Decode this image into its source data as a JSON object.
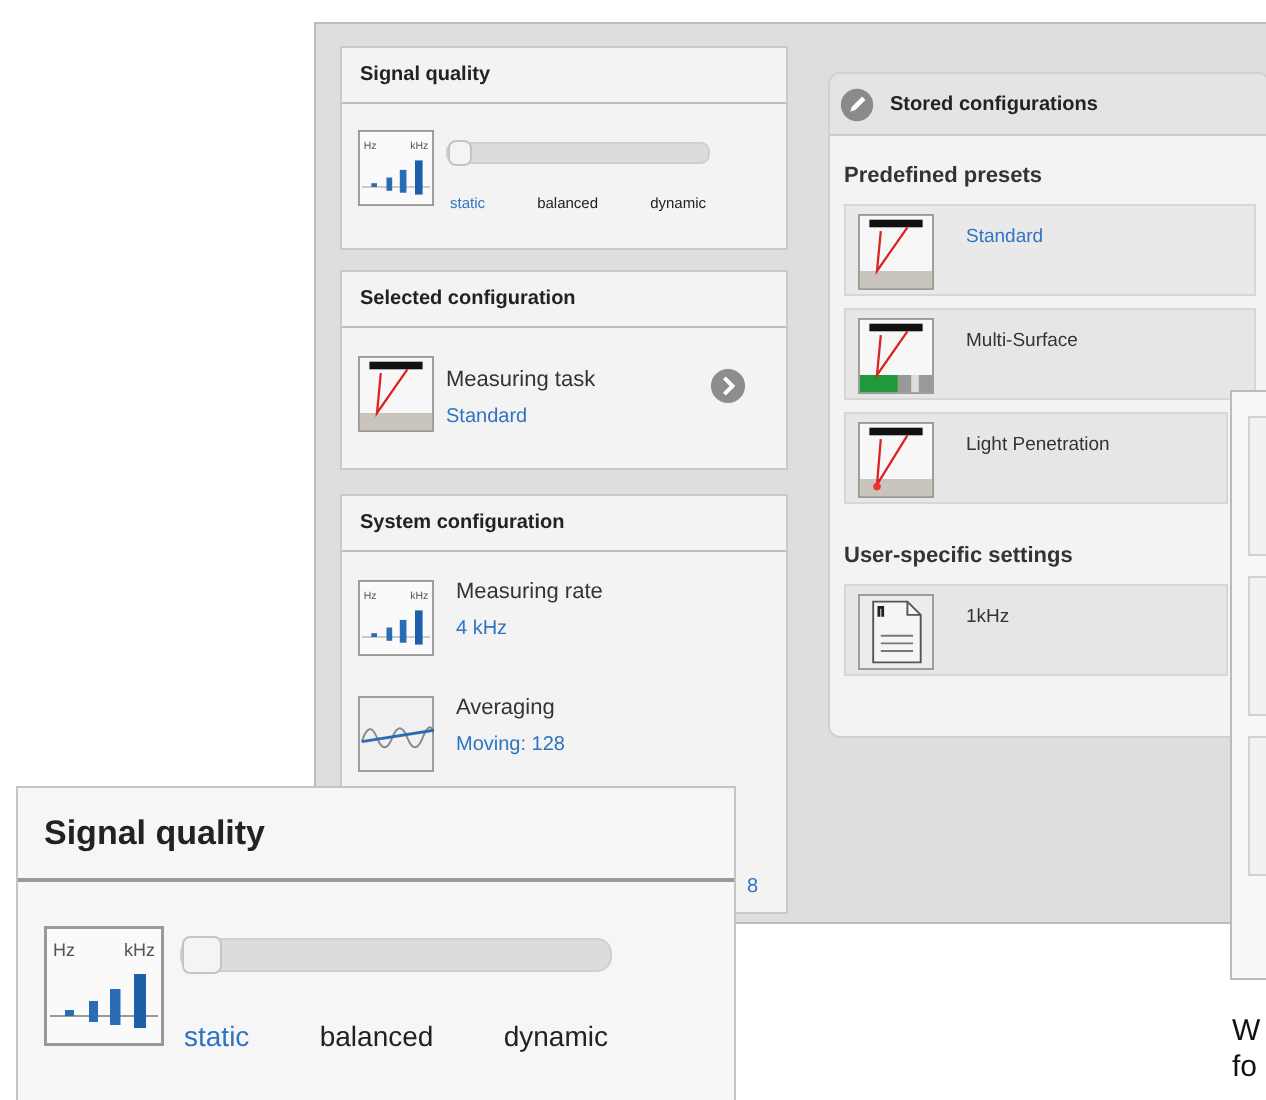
{
  "signal_quality": {
    "title": "Signal quality",
    "icon_labels": [
      "Hz",
      "kHz"
    ],
    "level": 0,
    "options": [
      {
        "label": "static",
        "selected": true
      },
      {
        "label": "balanced",
        "selected": false
      },
      {
        "label": "dynamic",
        "selected": false
      }
    ]
  },
  "selected_configuration": {
    "title": "Selected configuration",
    "label": "Measuring task",
    "value": "Standard"
  },
  "system_configuration": {
    "title": "System configuration",
    "items": [
      {
        "kind": "rate",
        "label": "Measuring rate",
        "value": "4 kHz",
        "icon_labels": [
          "Hz",
          "kHz"
        ]
      },
      {
        "kind": "averaging",
        "label": "Averaging",
        "value": "Moving: 128"
      },
      {
        "kind": "partial",
        "value": "8"
      }
    ]
  },
  "stored_configurations": {
    "title": "Stored configurations",
    "predefined": {
      "title": "Predefined presets",
      "items": [
        {
          "kind": "standard",
          "label": "Standard",
          "selected": true
        },
        {
          "kind": "multi",
          "label": "Multi-Surface",
          "selected": false
        },
        {
          "kind": "penetration",
          "label": "Light Penetration",
          "selected": false
        }
      ]
    },
    "user": {
      "title": "User-specific settings",
      "items": [
        {
          "kind": "file",
          "label": "1kHz",
          "selected": false
        }
      ]
    }
  },
  "inset": {
    "title": "Signal quality",
    "icon_labels": [
      "Hz",
      "kHz"
    ],
    "level": 0,
    "options": [
      {
        "label": "static",
        "selected": true
      },
      {
        "label": "balanced",
        "selected": false
      },
      {
        "label": "dynamic",
        "selected": false
      }
    ]
  },
  "text_fragment": [
    "W",
    "fo"
  ]
}
